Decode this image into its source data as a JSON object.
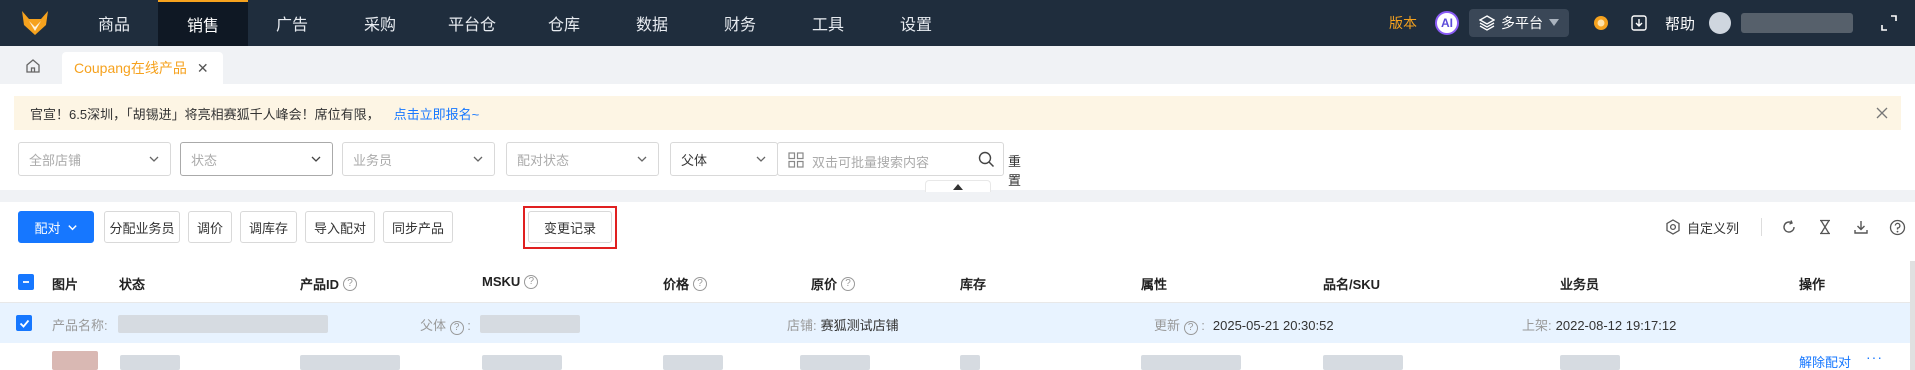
{
  "nav": {
    "items": [
      "商品",
      "销售",
      "广告",
      "采购",
      "平台仓",
      "仓库",
      "数据",
      "财务",
      "工具",
      "设置"
    ],
    "active_index": 1,
    "version_label": "版本",
    "ai_label": "AI",
    "platform_label": "多平台",
    "help_label": "帮助"
  },
  "tabs": {
    "page_tab_label": "Coupang在线产品",
    "close_symbol": "✕"
  },
  "notice": {
    "text": "官宣！6.5深圳，「胡锡进」将亮相赛狐千人峰会！席位有限，",
    "link": "点击立即报名~"
  },
  "filters": {
    "store_placeholder": "全部店铺",
    "status_placeholder": "状态",
    "salesperson_placeholder": "业务员",
    "pair_status_placeholder": "配对状态",
    "search_type": "父体",
    "search_placeholder": "双击可批量搜索内容",
    "reset_label": "重置"
  },
  "toolbar": {
    "pair_label": "配对",
    "assign_label": "分配业务员",
    "price_label": "调价",
    "stock_label": "调库存",
    "import_label": "导入配对",
    "sync_label": "同步产品",
    "changelog_label": "变更记录",
    "custom_cols_label": "自定义列"
  },
  "table": {
    "headers": {
      "image": "图片",
      "status": "状态",
      "product_id": "产品ID",
      "msku": "MSKU",
      "price": "价格",
      "original_price": "原价",
      "stock": "库存",
      "attribute": "属性",
      "name_sku": "品名/SKU",
      "salesperson": "业务员",
      "actions": "操作"
    },
    "row": {
      "name_label": "产品名称:",
      "parent_label": "父体",
      "store_label": "店铺:",
      "store_value": "赛狐测试店铺",
      "updated_label": "更新",
      "updated_value": "2025-05-21 20:30:52",
      "listed_label": "上架:",
      "listed_value": "2022-08-12 19:17:12",
      "unpair_label": "解除配对",
      "more_label": "···"
    }
  },
  "colors": {
    "nav_bg": "#1f2d3d",
    "accent_orange": "#f6a21e",
    "primary_blue": "#1677ff",
    "highlight_red": "#e02020"
  }
}
